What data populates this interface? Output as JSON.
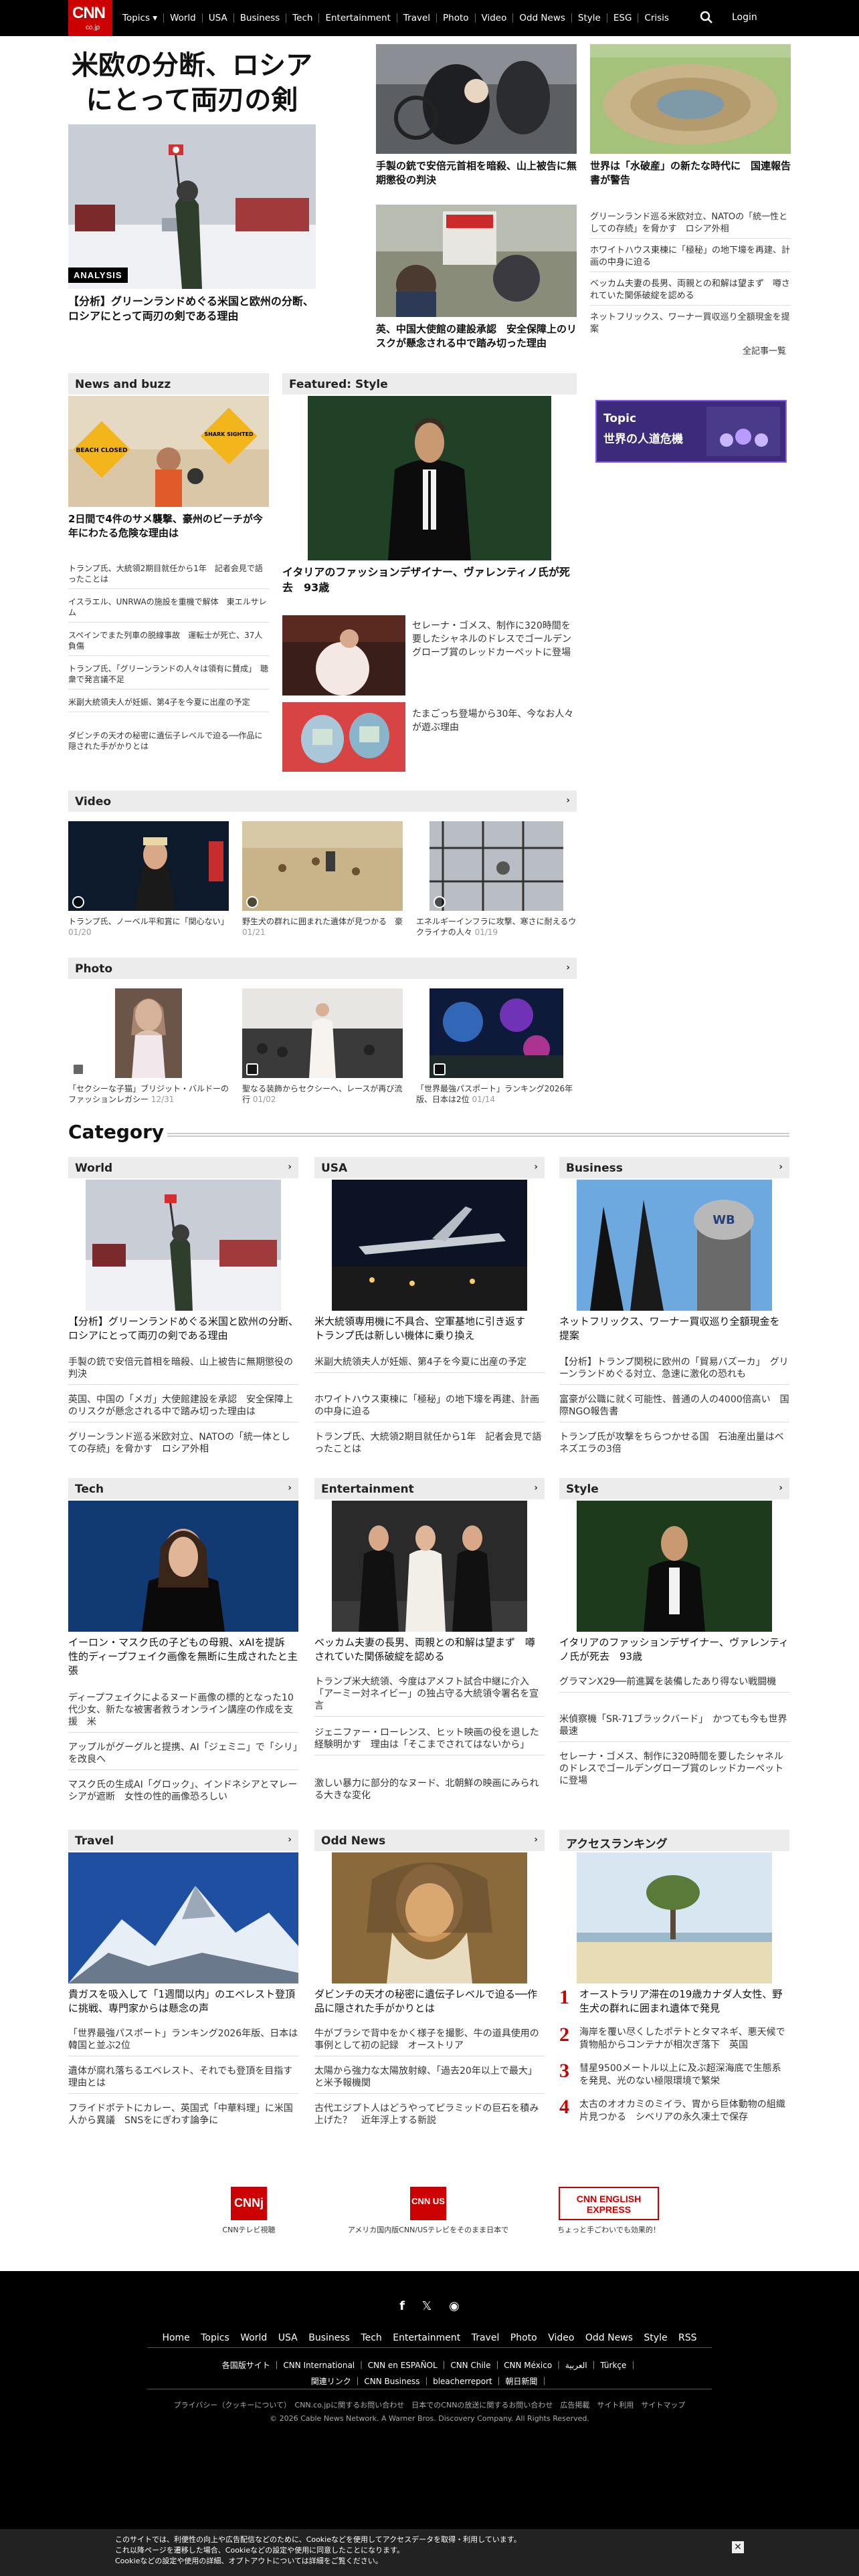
{
  "header": {
    "logo_text": "CNN",
    "logo_sub": "co.jp",
    "nav": [
      "Topics ▾",
      "World",
      "USA",
      "Business",
      "Tech",
      "Entertainment",
      "Travel",
      "Photo",
      "Video",
      "Odd News",
      "Style",
      "ESG",
      "Crisis"
    ],
    "login": "Login"
  },
  "hero": {
    "title_line1": "米欧の分断、ロシア",
    "title_line2": "にとって両刃の剣",
    "badge": "ANALYSIS",
    "headline": "【分析】グリーンランドめぐる米国と欧州の分断、ロシアにとって両刃の剣である理由"
  },
  "top_stories": [
    {
      "headline": "手製の銃で安倍元首相を暗殺、山上被告に無期懲役の判決"
    },
    {
      "headline": "世界は「水破産」の新たな時代に　国連報告書が警告"
    },
    {
      "headline": "英、中国大使館の建設承認　安全保障上のリスクが懸念される中で踏み切った理由"
    }
  ],
  "right_links": [
    "グリーンランド巡る米欧対立、NATOの「統一性としての存続」を脅かす　ロシア外相",
    "ホワイトハウス東棟に「極秘」の地下壕を再建、計画の中身に迫る",
    "ベッカム夫妻の長男、両親との和解は望まず　噂されていた関係破綻を認める",
    "ネットフリックス、ワーナー買収巡り全額現金を提案"
  ],
  "all_headlines": "全記事一覧",
  "news_buzz": {
    "header": "News and buzz",
    "headline": "2日間で4件のサメ襲撃、豪州のビーチが今年にわたる危険な理由は",
    "links": [
      "トランプ氏、大統領2期目就任から1年　記者会見で語ったことは",
      "イスラエル、UNRWAの施設を重機で解体　東エルサレム",
      "スペインでまた列車の脱線事故　運転士が死亡、37人負傷",
      "トランプ氏、「グリーンランドの人々は領有に賛成」　聴衆で発言議不足",
      "米副大統領夫人が妊娠、第4子を今夏に出産の予定",
      "ダビンチの天才の秘密に遺伝子レベルで迫る──作品に隠された手がかりとは"
    ],
    "sign_left": "BEACH CLOSED",
    "sign_right": "SHARK SIGHTED"
  },
  "featured": {
    "header": "Featured: Style",
    "headline": "イタリアのファッションデザイナー、ヴァレンティノ氏が死去　93歳",
    "items": [
      "セレーナ・ゴメス、制作に320時間を要したシャネルのドレスでゴールデングローブ賞のレッドカーペットに登場",
      "たまごっち登場から30年、今なお人々が遊ぶ理由"
    ]
  },
  "topic": {
    "label": "Topic",
    "title": "世界の人道危機"
  },
  "video": {
    "header": "Video",
    "items": [
      {
        "caption": "トランプ氏、ノーベル平和賞に「関心ない」",
        "date": "01/20"
      },
      {
        "caption": "野生犬の群れに囲まれた遺体が見つかる　豪",
        "date": "01/21"
      },
      {
        "caption": "エネルギーインフラに攻撃、寒さに耐えるウクライナの人々",
        "date": "01/19"
      }
    ]
  },
  "photo": {
    "header": "Photo",
    "items": [
      {
        "caption": "「セクシーな子猫」ブリジット・バルドーのファッションレガシー",
        "date": "12/31"
      },
      {
        "caption": "聖なる装飾からセクシーへ、レースが再び流行",
        "date": "01/02"
      },
      {
        "caption": "「世界最強パスポート」ランキング2026年版、日本は2位",
        "date": "01/14"
      }
    ]
  },
  "category": {
    "title": "Category",
    "world": {
      "header": "World",
      "headline": "【分析】グリーンランドめぐる米国と欧州の分断、ロシアにとって両刃の剣である理由",
      "links": [
        "手製の銃で安倍元首相を暗殺、山上被告に無期懲役の判決",
        "英国、中国の「メガ」大使館建設を承認　安全保障上のリスクが懸念される中で踏み切った理由は",
        "グリーンランド巡る米欧対立、NATOの「統一体としての存続」を脅かす　ロシア外相"
      ]
    },
    "usa": {
      "header": "USA",
      "headline": "米大統領専用機に不具合、空軍基地に引き返す　トランプ氏は新しい機体に乗り換え",
      "links": [
        "米副大統領夫人が妊娠、第4子を今夏に出産の予定",
        "ホワイトハウス東棟に「極秘」の地下壕を再建、計画の中身に迫る",
        "トランプ氏、大統領2期目就任から1年　記者会見で語ったことは"
      ]
    },
    "business": {
      "header": "Business",
      "headline": "ネットフリックス、ワーナー買収巡り全額現金を提案",
      "links": [
        "【分析】トランプ関税に欧州の「貿易バズーカ」　グリーンランドめぐる対立、急速に激化の恐れも",
        "富豪が公職に就く可能性、普通の人の4000倍高い　国際NGO報告書",
        "トランプ氏が攻撃をちらつかせる国　石油産出量はベネズエラの3倍"
      ]
    },
    "tech": {
      "header": "Tech",
      "headline": "イーロン・マスク氏の子どもの母親、xAIを提訴　性的ディープフェイク画像を無断に生成されたと主張",
      "links": [
        "ディープフェイクによるヌード画像の標的となった10代少女、新たな被害者救うオンライン講座の作成を支援　米",
        "アップルがグーグルと提携、AI「ジェミニ」で「シリ」を改良へ",
        "マスク氏の生成AI「グロック」、インドネシアとマレーシアが遮断　女性の性的画像恐ろしい"
      ]
    },
    "entertainment": {
      "header": "Entertainment",
      "headline": "ベッカム夫妻の長男、両親との和解は望まず　噂されていた関係破綻を認める",
      "links": [
        "トランプ米大統領、今度はアメフト試合中継に介入「アーミー対ネイビー」の独占守る大統領令署名を宣言",
        "ジェニファー・ローレンス、ヒット映画の役を退した経験明かす　理由は「そこまでされてはないから」",
        "激しい暴力に部分的なヌード、北朝鮮の映画にみられる大きな変化"
      ]
    },
    "style": {
      "header": "Style",
      "headline": "イタリアのファッションデザイナー、ヴァレンティノ氏が死去　93歳",
      "links": [
        "グラマンX29──前進翼を装備したあり得ない戦闘機",
        "米偵察機「SR-71ブラックバード」　かつても今も世界最速",
        "セレーナ・ゴメス、制作に320時間を要したシャネルのドレスでゴールデングローブ賞のレッドカーペットに登場"
      ]
    },
    "travel": {
      "header": "Travel",
      "headline": "貴ガスを吸入して「1週間以内」のエベレスト登頂に挑戦、専門家からは懸念の声",
      "links": [
        "「世界最強パスポート」ランキング2026年版、日本は韓国と並ぶ2位",
        "遺体が腐れ落ちるエベレスト、それでも登頂を目指す理由とは",
        "フライドポテトにカレー、英国式「中華料理」に米国人から異議　SNSをにぎわす論争に"
      ]
    },
    "odd_news": {
      "header": "Odd News",
      "headline": "ダビンチの天才の秘密に遺伝子レベルで迫る──作品に隠された手がかりとは",
      "links": [
        "牛がブラシで背中をかく様子を撮影、牛の道具使用の事例として初の記録　オーストリア",
        "太陽から強力な太陽放射線、「過去20年以上で最大」と米予報機関",
        "古代エジプト人はどうやってピラミッドの巨石を積み上げた？　近年浮上する新説"
      ]
    },
    "ranking": {
      "header": "アクセスランキング",
      "items": [
        {
          "num": "1",
          "text": "オーストラリア滞在の19歳カナダ人女性、野生犬の群れに囲まれ遺体で発見"
        },
        {
          "num": "2",
          "text": "海岸を覆い尽くしたポテトとタマネギ、悪天候で貨物船からコンテナが相次ぎ落下　英国"
        },
        {
          "num": "3",
          "text": "彗星9500メートル以上に及ぶ超深海底で生態系を発見、光のない極限環境で繁栄"
        },
        {
          "num": "4",
          "text": "太古のオオカミのミイラ、胃から巨体動物の組織片見つかる　シベリアの永久凍土で保存"
        }
      ]
    }
  },
  "partners": [
    {
      "logo": "CNNj",
      "caption": "CNNテレビ視聴"
    },
    {
      "logo": "CNN US",
      "caption": "アメリカ国内版CNN/USテレビをそのまま日本で"
    },
    {
      "logo": "CNN ENGLISH EXPRESS",
      "caption": "ちょっと手ごわいでも効果的！"
    }
  ],
  "footer": {
    "nav": [
      "Home",
      "Topics",
      "World",
      "USA",
      "Business",
      "Tech",
      "Entertainment",
      "Travel",
      "Photo",
      "Video",
      "Odd News",
      "Style",
      "RSS"
    ],
    "sites_line1": "各国版サイト ｜ CNN International ｜ CNN en ESPAÑOL ｜ CNN Chile ｜ CNN México ｜ العربية ｜ Türkçe ｜",
    "sites_line2": "関連リンク ｜ CNN Business ｜ bleacherreport ｜ 朝日新聞 ｜",
    "legal": "プライバシー（クッキーについて）　CNN.co.jpに関するお問い合わせ　日本でのCNNの放送に関するお問い合わせ　広告掲載　サイト利用　サイトマップ",
    "copyright": "© 2026 Cable News Network. A Warner Bros. Discovery Company. All Rights Reserved."
  },
  "cookie": {
    "line1": "このサイトでは、利便性の向上や広告配信などのために、Cookieなどを使用してアクセスデータを取得・利用しています。",
    "line2": "これ以降ページを遷移した場合、Cookieなどの設定や使用に同意したことになります。",
    "line3": "Cookieなどの設定や使用の詳細、オプトアウトについては詳細をご覧ください。"
  }
}
